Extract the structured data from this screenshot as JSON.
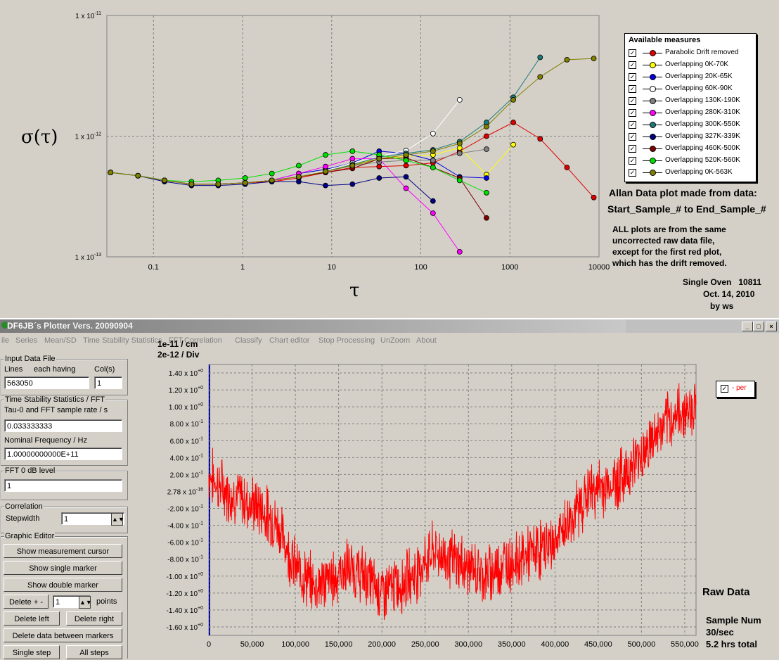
{
  "allan": {
    "ylabel": "σ(τ)",
    "xlabel": "τ",
    "y_ticks": [
      "1 x 10-11",
      "1 x 10-12",
      "1 x 10-13"
    ],
    "x_ticks": [
      "0.1",
      "1",
      "10",
      "100",
      "1000",
      "10000"
    ],
    "legend_title": "Available measures",
    "legend": [
      {
        "label": "Parabolic Drift removed",
        "color": "#e00000",
        "checked": "✓"
      },
      {
        "label": "Overlapping 0K-70K",
        "color": "#ffff00",
        "checked": "✓"
      },
      {
        "label": "Overlapping 20K-65K",
        "color": "#0000e0",
        "checked": "✓"
      },
      {
        "label": "Overlapping 60K-90K",
        "color": "#ffffff",
        "checked": "✓"
      },
      {
        "label": "Overlapping 130K-190K",
        "color": "#808080",
        "checked": "✓"
      },
      {
        "label": "Overlapping 280K-310K",
        "color": "#ff00ff",
        "checked": "✓"
      },
      {
        "label": "Overlapping 300K-550K",
        "color": "#1a7a7a",
        "checked": "✓"
      },
      {
        "label": "Overlapping 327K-339K",
        "color": "#000080",
        "checked": "✓"
      },
      {
        "label": "Overlapping 460K-500K",
        "color": "#800000",
        "checked": "✓"
      },
      {
        "label": "Overlapping 520K-560K",
        "color": "#00e000",
        "checked": "✓"
      },
      {
        "label": "Overlapping 0K-563K",
        "color": "#808000",
        "checked": "✓"
      }
    ],
    "note_heading_1": "Allan Data plot made from data:",
    "note_heading_2": "Start_Sample_# to End_Sample_#",
    "note_lines": [
      "ALL plots are from the same",
      "uncorrected raw data  file,",
      "except for the first red plot,",
      "which has the drift removed."
    ],
    "oven_line": "Single Oven   10811",
    "date_line": "Oct. 14, 2010",
    "by_line": "by ws"
  },
  "chart_data": [
    {
      "type": "line",
      "ylabel": "σ(τ)",
      "xlabel": "τ",
      "log_x": true,
      "log_y": true,
      "xlim": [
        0.03,
        10000
      ],
      "ylim": [
        1e-13,
        1e-11
      ],
      "grid": true,
      "legend_position": "right",
      "series": [
        {
          "name": "Parabolic Drift removed",
          "x": [
            0.033,
            0.067,
            0.133,
            0.267,
            0.533,
            1.07,
            2.13,
            4.27,
            8.53,
            17.1,
            34.1,
            68.3,
            137,
            273,
            546,
            1092,
            2185,
            4369,
            8738
          ],
          "y": [
            5e-13,
            4.7e-13,
            4.3e-13,
            4e-13,
            4e-13,
            4.1e-13,
            4.2e-13,
            4.5e-13,
            5e-13,
            5.5e-13,
            5.6e-13,
            5.7e-13,
            6e-13,
            7.5e-13,
            1e-12,
            1.3e-12,
            9.5e-13,
            5.5e-13,
            3.1e-13
          ]
        },
        {
          "name": "Overlapping 0K-70K",
          "x": [
            0.033,
            0.067,
            0.133,
            0.267,
            0.533,
            1.07,
            2.13,
            4.27,
            8.53,
            17.1,
            34.1,
            68.3,
            137,
            273,
            546,
            1092
          ],
          "y": [
            5e-13,
            4.7e-13,
            4.3e-13,
            4e-13,
            4e-13,
            4.1e-13,
            4.3e-13,
            4.6e-13,
            5.1e-13,
            5.8e-13,
            6.5e-13,
            6.8e-13,
            7e-13,
            8e-13,
            4.8e-13,
            8.5e-13
          ]
        },
        {
          "name": "Overlapping 20K-65K",
          "x": [
            0.033,
            0.067,
            0.133,
            0.267,
            0.533,
            1.07,
            2.13,
            4.27,
            8.53,
            17.1,
            34.1,
            68.3,
            137,
            273,
            546
          ],
          "y": [
            5e-13,
            4.7e-13,
            4.3e-13,
            4e-13,
            4e-13,
            4.1e-13,
            4.3e-13,
            4.9e-13,
            5.3e-13,
            6e-13,
            7.5e-13,
            7.2e-13,
            6.3e-13,
            4.6e-13,
            4.5e-13
          ]
        },
        {
          "name": "Overlapping 60K-90K",
          "x": [
            0.033,
            0.067,
            0.133,
            0.267,
            0.533,
            1.07,
            2.13,
            4.27,
            8.53,
            17.1,
            34.1,
            68.3,
            137,
            273
          ],
          "y": [
            5e-13,
            4.7e-13,
            4.3e-13,
            4e-13,
            4e-13,
            4.1e-13,
            4.3e-13,
            4.6e-13,
            5.2e-13,
            6e-13,
            6.8e-13,
            7.6e-13,
            1.05e-12,
            2e-12
          ]
        },
        {
          "name": "Overlapping 130K-190K",
          "x": [
            0.033,
            0.067,
            0.133,
            0.267,
            0.533,
            1.07,
            2.13,
            4.27,
            8.53,
            17.1,
            34.1,
            68.3,
            137,
            273,
            546
          ],
          "y": [
            5e-13,
            4.7e-13,
            4.3e-13,
            4e-13,
            4e-13,
            4.1e-13,
            4.3e-13,
            4.6e-13,
            5.1e-13,
            5.7e-13,
            6.1e-13,
            6.3e-13,
            6.3e-13,
            7.2e-13,
            7.8e-13
          ]
        },
        {
          "name": "Overlapping 280K-310K",
          "x": [
            0.033,
            0.067,
            0.133,
            0.267,
            0.533,
            1.07,
            2.13,
            4.27,
            8.53,
            17.1,
            34.1,
            68.3,
            137,
            273
          ],
          "y": [
            5e-13,
            4.7e-13,
            4.3e-13,
            4e-13,
            4e-13,
            4.1e-13,
            4.3e-13,
            4.9e-13,
            5.6e-13,
            6.5e-13,
            6.5e-13,
            3.7e-13,
            2.3e-13,
            1.1e-13
          ]
        },
        {
          "name": "Overlapping 300K-550K",
          "x": [
            0.033,
            0.067,
            0.133,
            0.267,
            0.533,
            1.07,
            2.13,
            4.27,
            8.53,
            17.1,
            34.1,
            68.3,
            137,
            273,
            546,
            1092,
            2185
          ],
          "y": [
            5e-13,
            4.7e-13,
            4.3e-13,
            4e-13,
            4e-13,
            4.1e-13,
            4.3e-13,
            4.6e-13,
            5.1e-13,
            5.8e-13,
            6.7e-13,
            7.2e-13,
            7.7e-13,
            9e-13,
            1.3e-12,
            2.1e-12,
            4.5e-12
          ]
        },
        {
          "name": "Overlapping 327K-339K",
          "x": [
            0.033,
            0.067,
            0.133,
            0.267,
            0.533,
            1.07,
            2.13,
            4.27,
            8.53,
            17.1,
            34.1,
            68.3,
            137
          ],
          "y": [
            5e-13,
            4.7e-13,
            4.2e-13,
            3.9e-13,
            3.9e-13,
            4e-13,
            4.2e-13,
            4.2e-13,
            3.9e-13,
            4e-13,
            4.5e-13,
            4.6e-13,
            2.9e-13
          ]
        },
        {
          "name": "Overlapping 460K-500K",
          "x": [
            0.033,
            0.067,
            0.133,
            0.267,
            0.533,
            1.07,
            2.13,
            4.27,
            8.53,
            17.1,
            34.1,
            68.3,
            137,
            273,
            546
          ],
          "y": [
            5e-13,
            4.7e-13,
            4.3e-13,
            4e-13,
            4e-13,
            4.1e-13,
            4.3e-13,
            4.6e-13,
            5e-13,
            5.4e-13,
            6.5e-13,
            6.6e-13,
            5.5e-13,
            4.5e-13,
            2.1e-13
          ]
        },
        {
          "name": "Overlapping 520K-560K",
          "x": [
            0.033,
            0.067,
            0.133,
            0.267,
            0.533,
            1.07,
            2.13,
            4.27,
            8.53,
            17.1,
            34.1,
            68.3,
            137,
            273,
            546
          ],
          "y": [
            5e-13,
            4.7e-13,
            4.3e-13,
            4.2e-13,
            4.3e-13,
            4.5e-13,
            4.9e-13,
            5.7e-13,
            7e-13,
            7.5e-13,
            7e-13,
            6.3e-13,
            5.5e-13,
            4.3e-13,
            3.4e-13
          ]
        },
        {
          "name": "Overlapping 0K-563K",
          "x": [
            0.033,
            0.067,
            0.133,
            0.267,
            0.533,
            1.07,
            2.13,
            4.27,
            8.53,
            17.1,
            34.1,
            68.3,
            137,
            273,
            546,
            1092,
            2185,
            4369,
            8738
          ],
          "y": [
            5e-13,
            4.7e-13,
            4.3e-13,
            4e-13,
            4e-13,
            4.1e-13,
            4.3e-13,
            4.6e-13,
            5.1e-13,
            5.7e-13,
            6.5e-13,
            7e-13,
            7.5e-13,
            8.7e-13,
            1.2e-12,
            2e-12,
            3.1e-12,
            4.3e-12,
            4.4e-12
          ]
        }
      ]
    },
    {
      "type": "line",
      "title_lines": [
        "1e-11 / cm",
        "2e-12 / Div"
      ],
      "xlim": [
        0,
        563050
      ],
      "ylim": [
        -1.7,
        1.5
      ],
      "grid": true,
      "legend_position": "top-right",
      "x_ticks": [
        "0",
        "50,000",
        "100,000",
        "150,000",
        "200,000",
        "250,000",
        "300,000",
        "350,000",
        "400,000",
        "450,000",
        "500,000",
        "550,000"
      ],
      "y_ticks": [
        "1.40 x 10+0",
        "1.20 x 10+0",
        "1.00 x 10+0",
        "8.00 x 10-1",
        "6.00 x 10-1",
        "4.00 x 10-1",
        "2.00 x 10-1",
        "2.78 x 10-16",
        "-2.00 x 10-1",
        "-4.00 x 10-1",
        "-6.00 x 10-1",
        "-8.00 x 10-1",
        "-1.00 x 10+0",
        "-1.20 x 10+0",
        "-1.40 x 10+0",
        "-1.60 x 10+0"
      ],
      "series": [
        {
          "name": "per",
          "color": "#ff0000",
          "x": [
            0,
            20000,
            40000,
            60000,
            80000,
            100000,
            120000,
            140000,
            160000,
            180000,
            200000,
            220000,
            240000,
            260000,
            280000,
            300000,
            320000,
            340000,
            360000,
            380000,
            400000,
            420000,
            440000,
            460000,
            480000,
            500000,
            520000,
            540000,
            560000
          ],
          "y": [
            0.2,
            0.0,
            -0.1,
            -0.2,
            -0.4,
            -0.9,
            -1.1,
            -1.05,
            -0.9,
            -1.0,
            -1.2,
            -1.1,
            -0.95,
            -0.7,
            -0.8,
            -0.9,
            -1.0,
            -0.85,
            -0.8,
            -0.7,
            -0.6,
            -0.3,
            0.0,
            0.05,
            0.2,
            0.45,
            0.7,
            0.9,
            1.0
          ]
        }
      ]
    }
  ],
  "plotter": {
    "window_title": "DF6JB´s Plotter Vers. 20090904",
    "menus": [
      "ile",
      "Series",
      "Mean/SD",
      "Time Stability Statistics",
      "FFT",
      "Correlation",
      "Classify",
      "Chart editor",
      "Stop Processing",
      "UnZoom",
      "About"
    ],
    "input_file_group": "Input Data File",
    "lines_label": "Lines",
    "each_having_label": "each having",
    "cols_label": "Col(s)",
    "lines_value": "563050",
    "cols_value": "1",
    "tss_group": "Time Stability Statistics / FFT",
    "tau_label": "Tau-0 and FFT sample rate / s",
    "tau_value": "0.033333333",
    "nominal_label": "Nominal Frequency / Hz",
    "nominal_value": "1.00000000000E+11",
    "fft_group": "FFT 0 dB level",
    "fft_value": "1",
    "corr_group": "Correlation",
    "stepwidth_label": "Stepwidth",
    "stepwidth_value": "1",
    "graphic_group": "Graphic Editor",
    "btn_cursor": "Show measurement cursor",
    "btn_single": "Show single marker",
    "btn_double": "Show double marker",
    "btn_delete_pm": "Delete + -",
    "delete_points_value": "1",
    "points_label": "points",
    "btn_delete_left": "Delete left",
    "btn_delete_right": "Delete right",
    "btn_delete_between": "Delete data between markers",
    "btn_single_step": "Single step",
    "btn_all_steps": "All steps",
    "scale_line1": "1e-11 / cm",
    "scale_line2": "2e-12 / Div",
    "raw_data_label": "Raw Data",
    "sample_num_label": "Sample Num",
    "rate_label": "30/sec",
    "total_label": "5.2 hrs total",
    "legend_label": "- per",
    "legend_checked": "✓"
  }
}
